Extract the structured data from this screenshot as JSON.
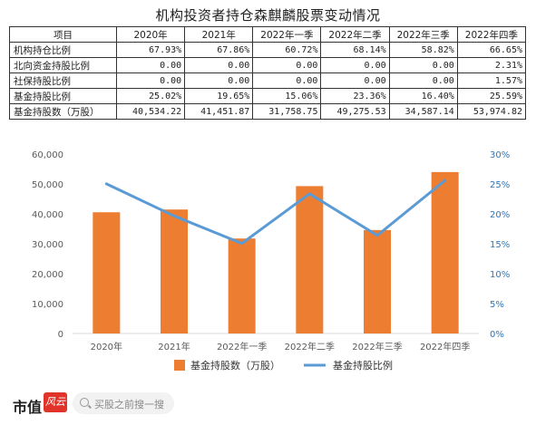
{
  "title": "机构投资者持仓森麒麟股票变动情况",
  "table": {
    "header": [
      "项目",
      "2020年",
      "2021年",
      "2022年一季",
      "2022年二季",
      "2022年三季",
      "2022年四季"
    ],
    "rows": [
      {
        "label": "机构持仓比例",
        "cells": [
          "67.93%",
          "67.86%",
          "60.72%",
          "68.14%",
          "58.82%",
          "66.65%"
        ]
      },
      {
        "label": "北向资金持股比例",
        "cells": [
          "0.00",
          "0.00",
          "0.00",
          "0.00",
          "0.00",
          "2.31%"
        ]
      },
      {
        "label": "社保持股比例",
        "cells": [
          "0.00",
          "0.00",
          "0.00",
          "0.00",
          "0.00",
          "1.57%"
        ]
      },
      {
        "label": "基金持股比例",
        "cells": [
          "25.02%",
          "19.65%",
          "15.06%",
          "23.36%",
          "16.40%",
          "25.59%"
        ]
      },
      {
        "label": "基金持股数（万股）",
        "cells": [
          "40,534.22",
          "41,451.87",
          "31,758.75",
          "49,275.53",
          "34,587.14",
          "53,974.82"
        ]
      }
    ]
  },
  "chart_data": {
    "type": "bar",
    "categories": [
      "2020年",
      "2021年",
      "2022年一季",
      "2022年二季",
      "2022年三季",
      "2022年四季"
    ],
    "series": [
      {
        "name": "基金持股数（万股）",
        "kind": "bar",
        "axis": "left",
        "color": "#ed7d31",
        "values": [
          40534.22,
          41451.87,
          31758.75,
          49275.53,
          34587.14,
          53974.82
        ]
      },
      {
        "name": "基金持股比例",
        "kind": "line",
        "axis": "right",
        "color": "#5b9bd5",
        "values": [
          25.02,
          19.65,
          15.06,
          23.36,
          16.4,
          25.59
        ]
      }
    ],
    "y_left": {
      "min": 0,
      "max": 60000,
      "step": 10000,
      "tick_labels": [
        "0",
        "10,000",
        "20,000",
        "30,000",
        "40,000",
        "50,000",
        "60,000"
      ]
    },
    "y_right": {
      "min": 0,
      "max": 30,
      "step": 5,
      "tick_labels": [
        "0%",
        "5%",
        "10%",
        "15%",
        "20%",
        "25%",
        "30%"
      ]
    },
    "grid": false,
    "legend_position": "bottom"
  },
  "footer": {
    "brand": "市值",
    "brand_mark": "风云",
    "search_placeholder": "买股之前搜一搜"
  }
}
